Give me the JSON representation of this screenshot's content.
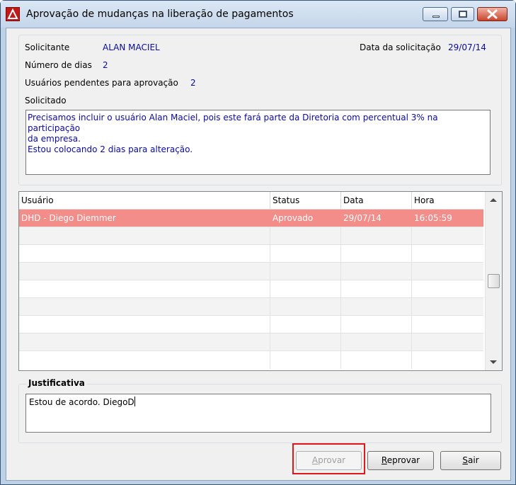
{
  "window": {
    "title": "Aprovação de mudanças na liberação de pagamentos"
  },
  "request": {
    "requester_label": "Solicitante",
    "requester_value": "ALAN MACIEL",
    "date_label": "Data da solicitação",
    "date_value": "29/07/14",
    "days_label": "Número de dias",
    "days_value": "2",
    "pending_label": "Usuários pendentes para aprovação",
    "pending_value": "2",
    "requested_label": "Solicitado",
    "requested_line1": "Precisamos incluir o usuário Alan Maciel, pois este fará parte da Diretoria com percentual 3% na participação",
    "requested_line2": "da empresa.",
    "requested_line3": "Estou colocando 2 dias para alteração."
  },
  "grid": {
    "headers": [
      "Usuário",
      "Status",
      "Data",
      "Hora"
    ],
    "rows": [
      {
        "user": "DHD  -  Diego Diemmer",
        "status": "Aprovado",
        "date": "29/07/14",
        "time": "16:05:59"
      }
    ]
  },
  "justification": {
    "legend": "Justificativa",
    "text": "Estou de acordo. DiegoD"
  },
  "buttons": {
    "approve_first": "A",
    "approve_rest": "provar",
    "reject_first": "R",
    "reject_rest": "eprovar",
    "exit_first": "S",
    "exit_rest": "air"
  },
  "colors": {
    "selected_row": "#f38d8a",
    "value_text": "#0a0aa0",
    "highlight_box": "#e01818"
  }
}
